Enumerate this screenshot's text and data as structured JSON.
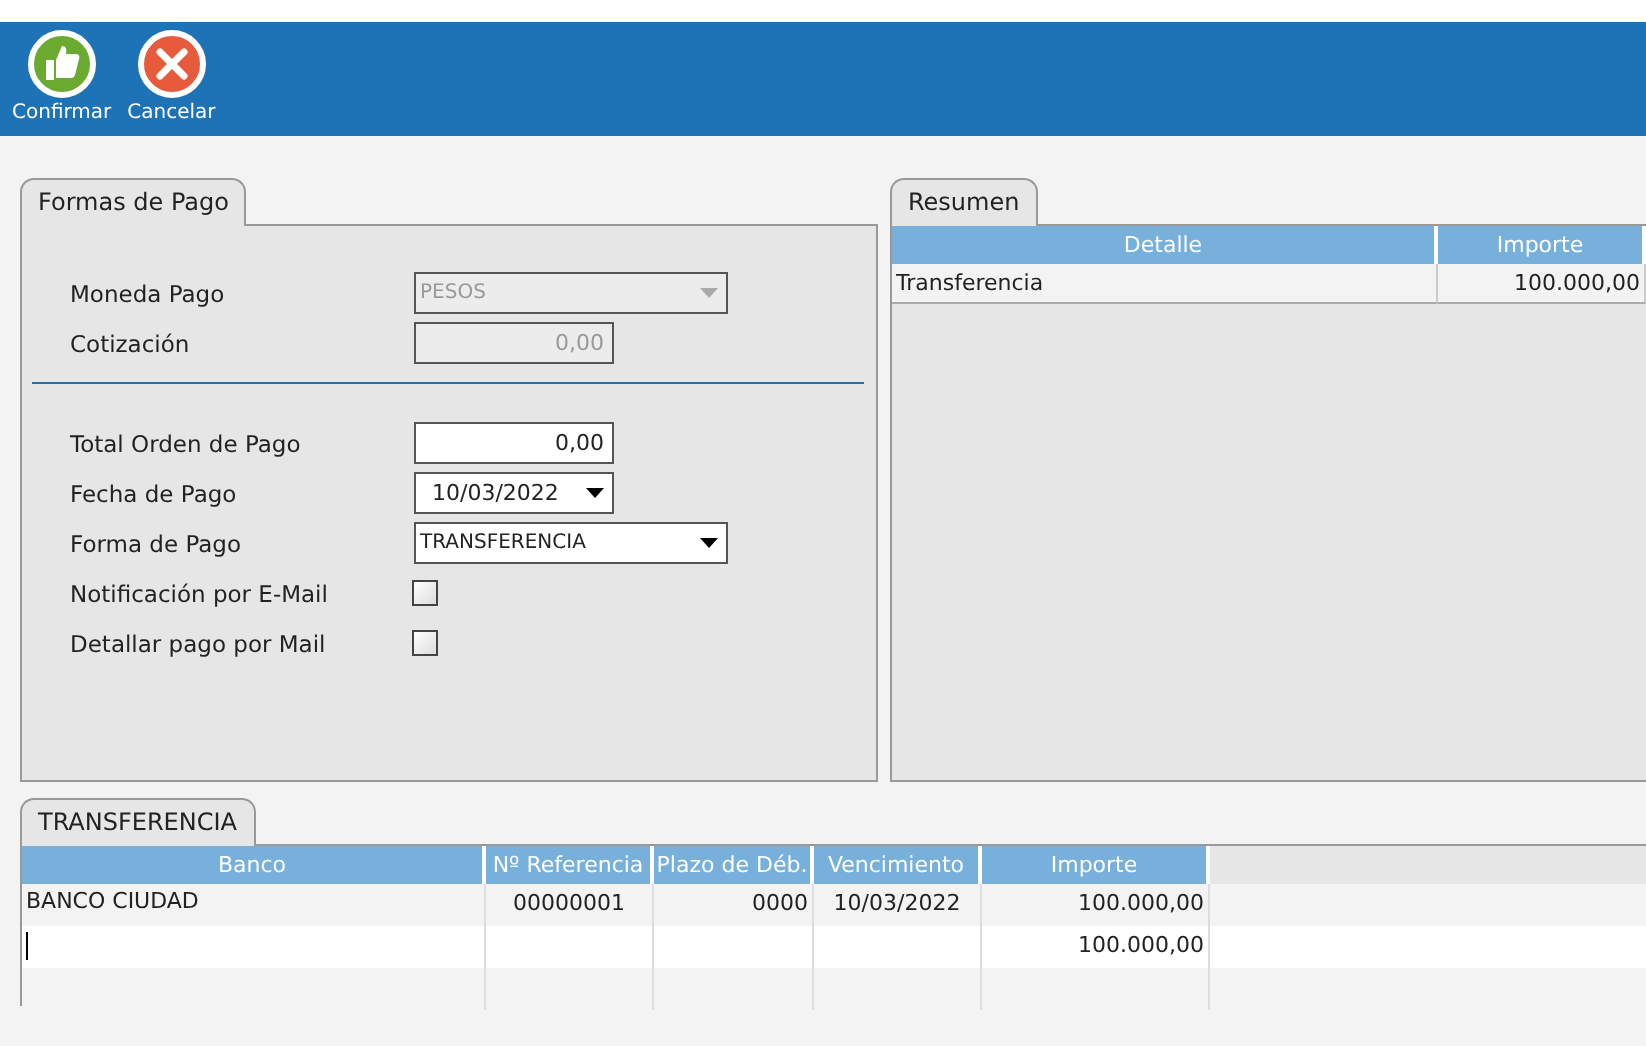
{
  "toolbar": {
    "buttons": [
      {
        "label": "Confirmar",
        "kind": "confirm"
      },
      {
        "label": "Cancelar",
        "kind": "cancel"
      }
    ]
  },
  "form_panel": {
    "tab": "Formas de Pago",
    "fields": [
      {
        "label": "Moneda Pago",
        "kind": "select",
        "value": "PESOS",
        "disabled": true
      },
      {
        "label": "Cotización",
        "kind": "number",
        "value": "0,00",
        "disabled": true
      },
      {
        "label": "Total Orden de Pago",
        "kind": "number",
        "value": "0,00",
        "disabled": false
      },
      {
        "label": "Fecha de Pago",
        "kind": "date",
        "value": "10/03/2022",
        "disabled": false
      },
      {
        "label": "Forma de Pago",
        "kind": "select",
        "value": "TRANSFERENCIA",
        "disabled": false
      },
      {
        "label": "Notificación por E-Mail",
        "kind": "checkbox",
        "checked": false
      },
      {
        "label": "Detallar pago por Mail",
        "kind": "checkbox",
        "checked": false
      }
    ]
  },
  "summary_panel": {
    "tab": "Resumen",
    "columns": [
      "Detalle",
      "Importe"
    ],
    "rows": [
      {
        "detalle": "Transferencia",
        "importe": "100.000,00"
      }
    ]
  },
  "transfer_panel": {
    "tab": "TRANSFERENCIA",
    "columns": [
      "Banco",
      "Nº Referencia",
      "Plazo de Déb.",
      "Vencimiento",
      "Importe"
    ],
    "rows": [
      {
        "cells": [
          "BANCO CIUDAD",
          "00000001",
          "0000",
          "10/03/2022",
          "100.000,00"
        ],
        "editing": false
      },
      {
        "cells": [
          null,
          null,
          null,
          null,
          "100.000,00"
        ],
        "editing": true
      }
    ]
  }
}
